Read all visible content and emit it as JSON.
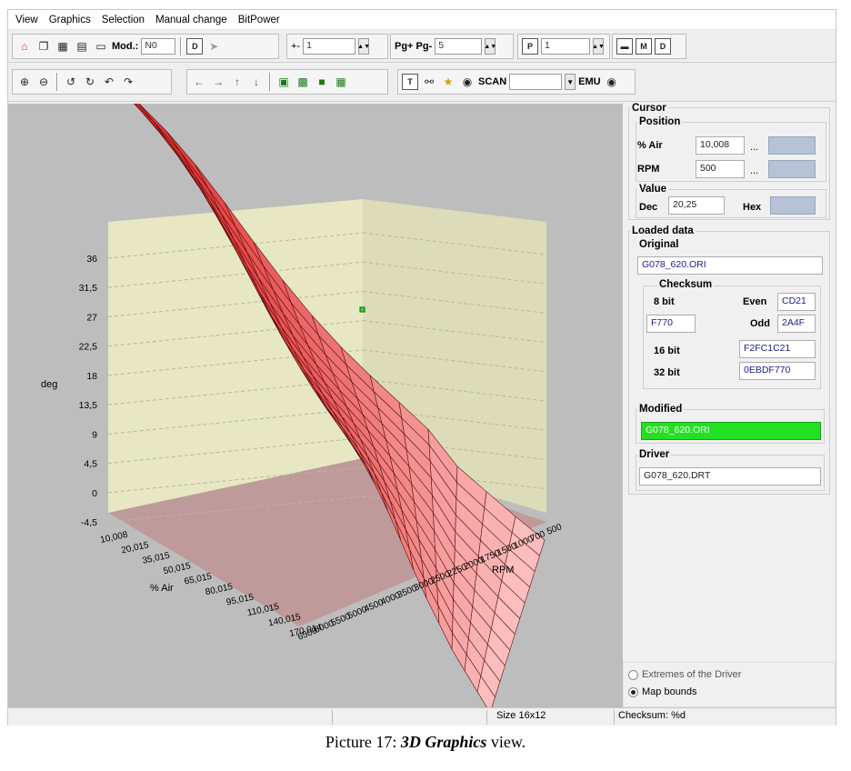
{
  "menu": [
    "View",
    "Graphics",
    "Selection",
    "Manual change",
    "BitPower"
  ],
  "toolbar1": {
    "mod_label": "Mod.:",
    "mod_value": "N0",
    "step_label": "+-",
    "step_value": "1",
    "pg_label": "Pg+ Pg-",
    "pg_value": "5",
    "p_icon": "P",
    "p_value": "1"
  },
  "toolbar2": {
    "scan_label": "SCAN",
    "scan_value": "",
    "emu_label": "EMU"
  },
  "chart_data": {
    "type": "surface3d",
    "zlabel": "deg",
    "xlabel": "RPM",
    "ylabel": "% Air",
    "z_ticks": [
      "36",
      "31,5",
      "27",
      "22,5",
      "18",
      "13,5",
      "9",
      "4,5",
      "0",
      "-4,5"
    ],
    "rpm_ticks": [
      "500",
      "700",
      "1000",
      "1500",
      "1750",
      "2000",
      "2250",
      "2500",
      "3000",
      "3500",
      "4000",
      "4500",
      "5000",
      "5500",
      "6000",
      "6500"
    ],
    "air_ticks": [
      "10,008",
      "20,015",
      "35,015",
      "50,015",
      "65,015",
      "80,015",
      "95,015",
      "110,015",
      "140,015",
      "170,014"
    ],
    "surface_color": "#ff3030",
    "floor_color": "#bf9a9a",
    "wall_color": "#e7e7c4"
  },
  "cursor": {
    "title": "Cursor",
    "position_title": "Position",
    "air_label": "% Air",
    "air_value": "10,008",
    "air_ellipsis": "...",
    "rpm_label": "RPM",
    "rpm_value": "500",
    "rpm_ellipsis": "...",
    "value_title": "Value",
    "dec_label": "Dec",
    "dec_value": "20,25",
    "hex_label": "Hex"
  },
  "loaded": {
    "title": "Loaded data",
    "original_title": "Original",
    "original_file": "G078_620.ORI",
    "checksum_title": "Checksum",
    "bit8_label": "8 bit",
    "even_label": "Even",
    "even_value": "CD21",
    "bit8_value": "F770",
    "odd_label": "Odd",
    "odd_value": "2A4F",
    "bit16_label": "16 bit",
    "bit16_value": "F2FC1C21",
    "bit32_label": "32 bit",
    "bit32_value": "0EBDF770",
    "modified_title": "Modified",
    "modified_file": "G078_620.ORI",
    "modified_color": "#22e022",
    "driver_title": "Driver",
    "driver_file": "G078_620.DRT"
  },
  "options": {
    "extremes_label": "Extremes of the Driver",
    "bounds_label": "Map bounds",
    "selected": "bounds"
  },
  "status": {
    "size": "Size 16x12",
    "checksum": "Checksum: %d"
  },
  "caption": {
    "prefix": "Picture 17: ",
    "italic": "3D Graphics",
    "suffix": " view."
  }
}
